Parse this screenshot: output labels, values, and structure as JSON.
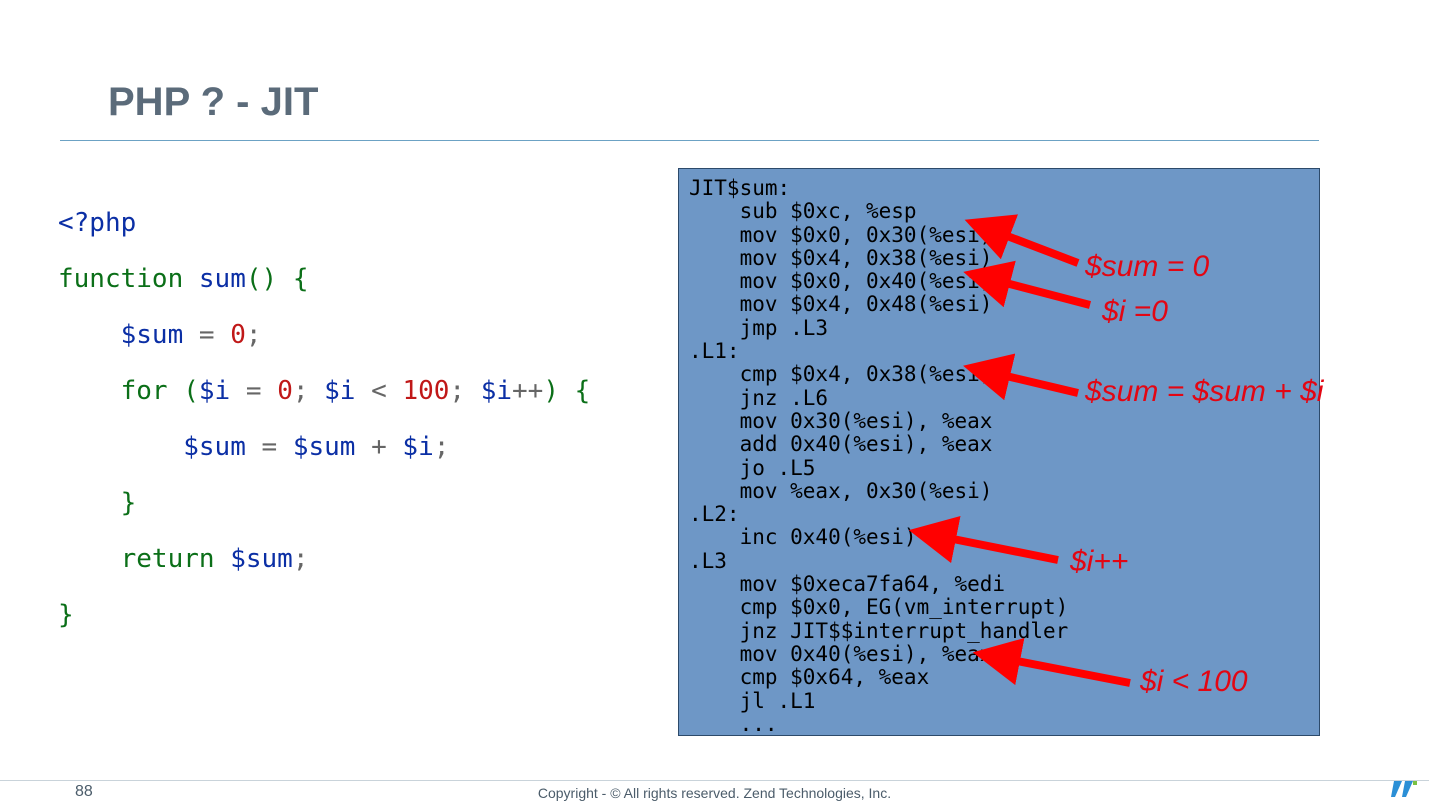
{
  "slide": {
    "title": "PHP ? - JIT",
    "page_number": "88",
    "copyright": "Copyright - © All rights reserved. Zend Technologies, Inc."
  },
  "php_code": {
    "l1": {
      "tag": "<?php"
    },
    "l2": {
      "kw": "function ",
      "fn": "sum",
      "paren": "() {"
    },
    "l3": {
      "indent": "    ",
      "var": "$sum",
      "op": " = ",
      "num": "0",
      "semi": ";"
    },
    "l4": {
      "indent": "    ",
      "kw": "for ",
      "p1": "(",
      "v1": "$i",
      "op1": " = ",
      "n1": "0",
      "s1": "; ",
      "v2": "$i",
      "op2": " < ",
      "n2": "100",
      "s2": "; ",
      "v3": "$i",
      "op3": "++",
      "p2": ") {"
    },
    "l5": {
      "indent": "        ",
      "v1": "$sum",
      "op1": " = ",
      "v2": "$sum",
      "op2": " + ",
      "v3": "$i",
      "semi": ";"
    },
    "l6": {
      "indent": "    ",
      "brace": "}"
    },
    "l7": {
      "indent": "    ",
      "kw": "return ",
      "var": "$sum",
      "semi": ";"
    },
    "l8": {
      "brace": "}"
    }
  },
  "asm": "JIT$sum:\n    sub $0xc, %esp\n    mov $0x0, 0x30(%esi)\n    mov $0x4, 0x38(%esi)\n    mov $0x0, 0x40(%esi)\n    mov $0x4, 0x48(%esi)\n    jmp .L3\n.L1:\n    cmp $0x4, 0x38(%esi)\n    jnz .L6\n    mov 0x30(%esi), %eax\n    add 0x40(%esi), %eax\n    jo .L5\n    mov %eax, 0x30(%esi)\n.L2:\n    inc 0x40(%esi)\n.L3\n    mov $0xeca7fa64, %edi\n    cmp $0x0, EG(vm_interrupt)\n    jnz JIT$$interrupt_handler\n    mov 0x40(%esi), %eax\n    cmp $0x64, %eax\n    jl .L1\n    ...",
  "annotations": {
    "a1": "$sum = 0",
    "a2": "$i =0",
    "a3": "$sum = $sum + $i",
    "a4": "$i++",
    "a5": "$i < 100"
  }
}
